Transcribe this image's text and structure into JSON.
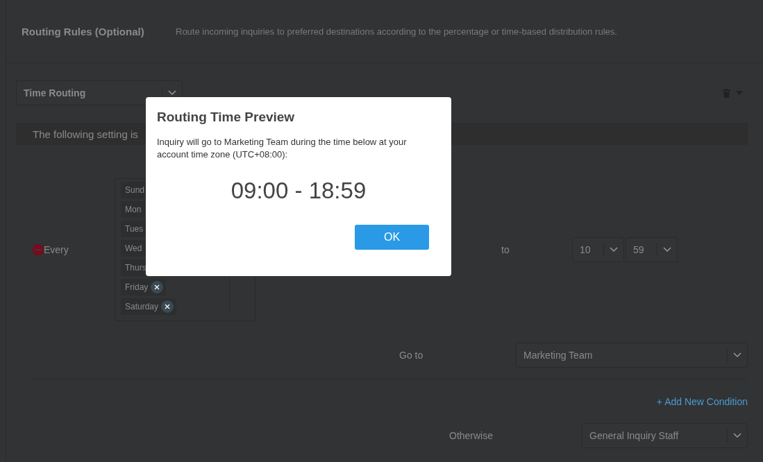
{
  "section": {
    "title": "Routing Rules (Optional)",
    "description": "Route incoming inquiries to preferred destinations according to the percentage or time-based distribution rules."
  },
  "routing_type": {
    "value": "Time Routing"
  },
  "banner": {
    "text": "The following setting is"
  },
  "condition": {
    "label": "Every",
    "days": [
      {
        "text": "Sund",
        "remove_icon": false
      },
      {
        "text": "Mon",
        "remove_icon": false
      },
      {
        "text": "Tues",
        "remove_icon": false
      },
      {
        "text": "Wed",
        "remove_icon": false
      },
      {
        "text": "Thurs",
        "remove_icon": false
      },
      {
        "text": "Friday",
        "remove_icon": true
      },
      {
        "text": "Saturday",
        "remove_icon": true
      }
    ],
    "to_label": "to",
    "end_hour": "10",
    "end_minute": "59",
    "goto_label": "Go to",
    "destination": "Marketing Team"
  },
  "add_condition": "+ Add New Condition",
  "otherwise": {
    "label": "Otherwise",
    "destination": "General Inquiry Staff"
  },
  "dialog": {
    "title": "Routing Time Preview",
    "message": "Inquiry will go to Marketing Team during the time below at your account time zone (UTC+08:00):",
    "time_range": "09:00 - 18:59",
    "ok_button": "OK"
  }
}
